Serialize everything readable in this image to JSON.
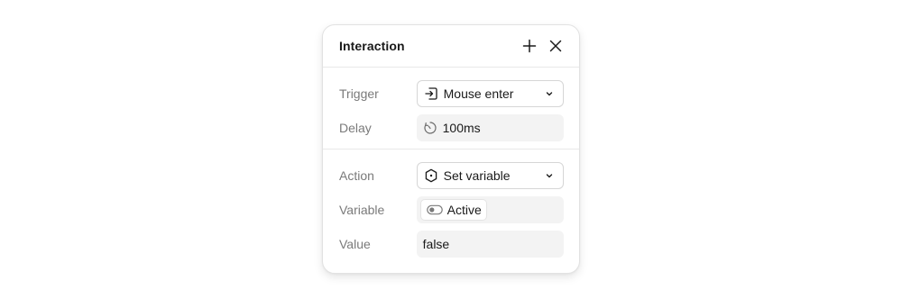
{
  "panel": {
    "title": "Interaction",
    "add_icon": "plus-icon",
    "close_icon": "close-icon"
  },
  "trigger_section": {
    "trigger": {
      "label": "Trigger",
      "value": "Mouse enter",
      "icon": "enter-icon"
    },
    "delay": {
      "label": "Delay",
      "value": "100ms",
      "icon": "timer-icon"
    }
  },
  "action_section": {
    "action": {
      "label": "Action",
      "value": "Set variable",
      "icon": "hexagon-icon"
    },
    "variable": {
      "label": "Variable",
      "value": "Active",
      "icon": "toggle-icon"
    },
    "value": {
      "label": "Value",
      "value": "false"
    }
  },
  "colors": {
    "label_text": "#7a7a7a",
    "field_fill": "#f3f3f3",
    "border": "#d6d6d6"
  }
}
